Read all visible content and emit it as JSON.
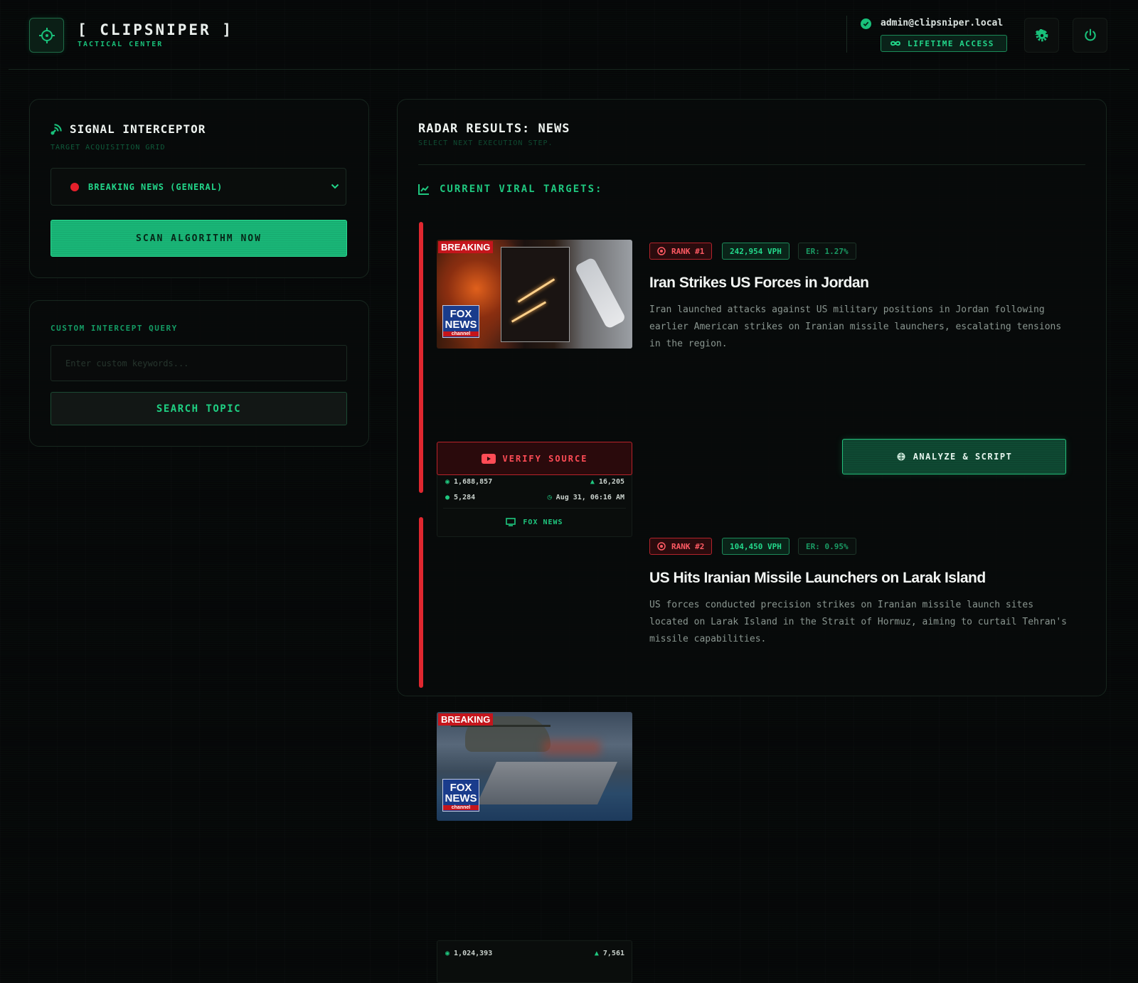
{
  "header": {
    "brand": "[ CLIPSNIPER ]",
    "subtitle": "TACTICAL CENTER",
    "email": "admin@clipsniper.local",
    "access_label": "LIFETIME ACCESS"
  },
  "interceptor": {
    "title": "SIGNAL INTERCEPTOR",
    "subtitle": "TARGET ACQUISITION GRID",
    "selected_feed": "BREAKING NEWS (GENERAL)",
    "scan_button": "SCAN ALGORITHM NOW"
  },
  "custom_query": {
    "label": "CUSTOM INTERCEPT QUERY",
    "placeholder": "Enter custom keywords...",
    "value": "",
    "search_button": "SEARCH TOPIC"
  },
  "radar": {
    "title": "RADAR RESULTS: NEWS",
    "subtitle": "SELECT NEXT EXECUTION STEP.",
    "section_label": "CURRENT VIRAL TARGETS:"
  },
  "results": [
    {
      "badge": "BREAKING",
      "rank": "RANK #1",
      "vph": "242,954 VPH",
      "er": "ER: 1.27%",
      "title": "Iran Strikes US Forces in Jordan",
      "description": "Iran launched attacks against US military positions in Jordan following earlier American strikes on Iranian missile launchers, escalating tensions in the region.",
      "views": "1,688,857",
      "likes": "16,205",
      "comments": "5,284",
      "date": "Aug 31, 06:16 AM",
      "source": "FOX NEWS",
      "verify_label": "VERIFY SOURCE",
      "analyze_label": "ANALYZE & SCRIPT"
    },
    {
      "badge": "BREAKING",
      "rank": "RANK #2",
      "vph": "104,450 VPH",
      "er": "ER: 0.95%",
      "title": "US Hits Iranian Missile Launchers on Larak Island",
      "description": "US forces conducted precision strikes on Iranian missile launch sites located on Larak Island in the Strait of Hormuz, aiming to curtail Tehran's missile capabilities.",
      "views": "1,024,393",
      "likes": "7,561"
    }
  ],
  "colors": {
    "accent": "#19c07a",
    "danger": "#e0272f",
    "background": "#060708"
  }
}
